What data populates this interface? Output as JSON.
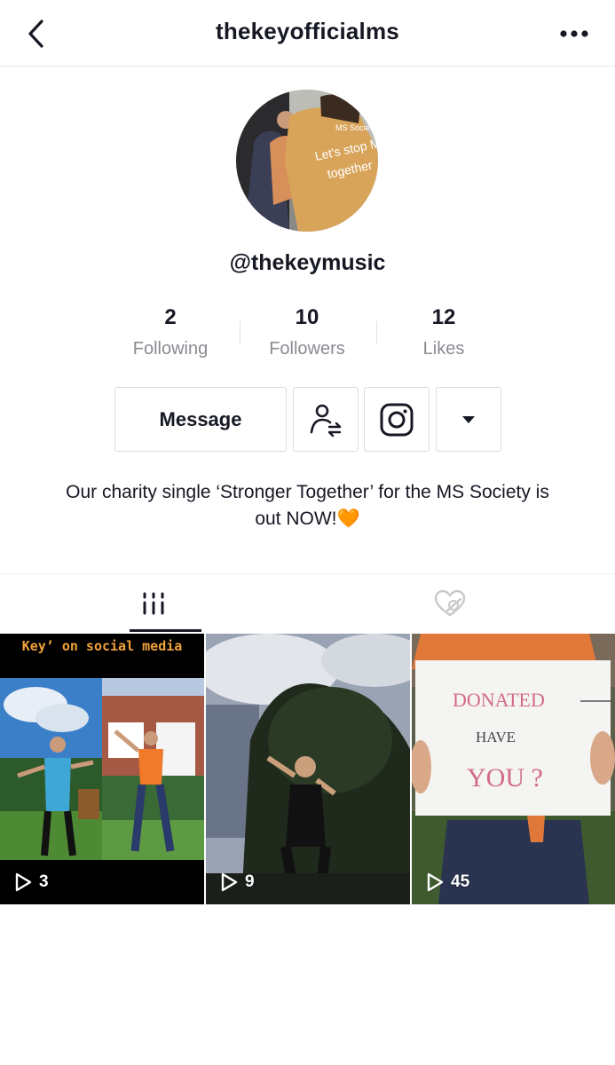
{
  "header": {
    "title": "thekeyofficialms",
    "back_icon": "chevron-left-icon",
    "more_icon": "more-horizontal-icon"
  },
  "profile": {
    "handle": "@thekeymusic",
    "avatar_shirt_text": "Let's stop MS together",
    "avatar_logo_text": "MS Society",
    "stats": [
      {
        "value": "2",
        "label": "Following"
      },
      {
        "value": "10",
        "label": "Followers"
      },
      {
        "value": "12",
        "label": "Likes"
      }
    ],
    "actions": {
      "message_label": "Message",
      "follow_icon": "user-switch-icon",
      "instagram_icon": "instagram-icon",
      "dropdown_icon": "caret-down-icon"
    },
    "bio": "Our charity single ‘Stronger Together’ for the MS Society is out NOW!🧡"
  },
  "tabs": [
    {
      "name": "videos",
      "icon": "grid-bars-icon",
      "active": true
    },
    {
      "name": "liked",
      "icon": "hidden-heart-icon",
      "active": false
    }
  ],
  "videos": [
    {
      "caption": "Key’ on social media",
      "views": "3"
    },
    {
      "caption": "",
      "views": "9"
    },
    {
      "sign_lines": [
        "DONATED",
        "HAVE",
        "YOU ?"
      ],
      "views": "45"
    }
  ],
  "colors": {
    "text": "#161823",
    "muted": "#8a8b91",
    "border": "#dcdcde",
    "accent_orange": "#f0a23a"
  }
}
